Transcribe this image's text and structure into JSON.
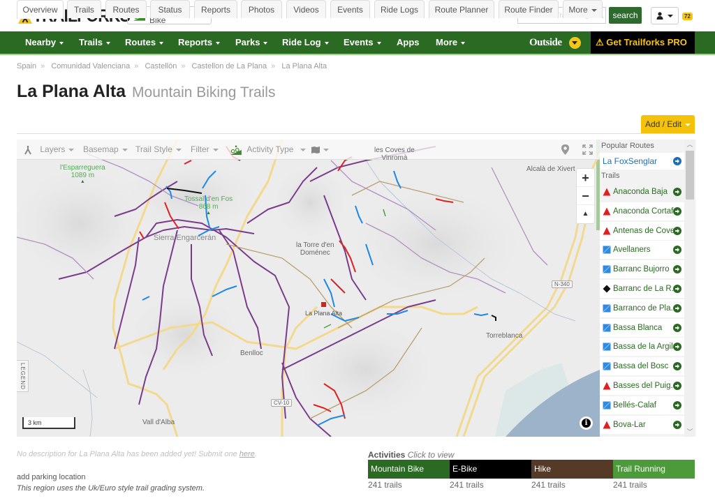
{
  "header": {
    "logo_text": "TRAILFORKS",
    "activity_select": "Mountain Bike",
    "search_placeholder": "Search for Trails, Regions, etc",
    "search_button": "search",
    "notification_count": "72"
  },
  "nav": {
    "items": [
      {
        "label": "Nearby",
        "dropdown": true
      },
      {
        "label": "Trails",
        "dropdown": true
      },
      {
        "label": "Routes",
        "dropdown": true
      },
      {
        "label": "Reports",
        "dropdown": true
      },
      {
        "label": "Parks",
        "dropdown": true
      },
      {
        "label": "Ride Log",
        "dropdown": true
      },
      {
        "label": "Events",
        "dropdown": true
      },
      {
        "label": "Apps",
        "dropdown": false
      },
      {
        "label": "More",
        "dropdown": true
      }
    ],
    "outside_label": "Outside",
    "pro_label": "Get Trailforks PRO"
  },
  "breadcrumb": [
    "Spain",
    "Comunidad Valenciana",
    "Castellón",
    "Castellon de La Plana",
    "La Plana Alta"
  ],
  "page": {
    "title": "La Plana Alta",
    "subtitle": "Mountain Biking Trails"
  },
  "tabs": [
    "Overview",
    "Trails",
    "Routes",
    "Status",
    "Reports",
    "Photos",
    "Videos",
    "Events",
    "Ride Logs",
    "Route Planner",
    "Route Finder",
    "More"
  ],
  "active_tab": "Overview",
  "add_edit_label": "Add / Edit",
  "map": {
    "toolbar": {
      "layers": "Layers",
      "basemap": "Basemap",
      "trail_style": "Trail Style",
      "filter": "Filter",
      "activity_type": "Activity Type"
    },
    "labels": {
      "esparreguera": "l'Esparreguera",
      "esparreguera_elev": "1089 m",
      "tossal": "Tossal d'en Fos",
      "tossal_elev": "868 m",
      "coves": "les Coves de",
      "coves2": "Vinromà",
      "alcala": "Alcalà de Xivert",
      "sierra": "Sierra Engarcerán",
      "torre": "la Torre d'en",
      "torre2": "Doménec",
      "plana": "La Plana Alta",
      "benlloc": "Benlloc",
      "torreblanca": "Torreblanca",
      "vall": "Vall d'Alba",
      "n340": "N-340",
      "cv10": "CV-10"
    },
    "legend_label": "LEGEND",
    "scale_label": "3 km",
    "zoom_in": "+",
    "zoom_out": "−"
  },
  "sidepanel": {
    "popular_routes_header": "Popular Routes",
    "popular_routes": [
      "La FoxSenglar"
    ],
    "trails_header": "Trails",
    "trails": [
      {
        "name": "Anaconda Baja",
        "difficulty": "red-triangle"
      },
      {
        "name": "Anaconda Cortaf...",
        "difficulty": "red-triangle"
      },
      {
        "name": "Antenas de Coves",
        "difficulty": "red-triangle"
      },
      {
        "name": "Avellaners",
        "difficulty": "blue-square"
      },
      {
        "name": "Barranc Bujorro",
        "difficulty": "blue-square"
      },
      {
        "name": "Barranc de La R...",
        "difficulty": "black-diamond"
      },
      {
        "name": "Barranco de Pla...",
        "difficulty": "blue-square"
      },
      {
        "name": "Bassa Blanca",
        "difficulty": "blue-square"
      },
      {
        "name": "Bassa de la Argila",
        "difficulty": "blue-square"
      },
      {
        "name": "Bassa del Bosc",
        "difficulty": "blue-square"
      },
      {
        "name": "Basses del Puig...",
        "difficulty": "red-triangle"
      },
      {
        "name": "Bellés-Calaf",
        "difficulty": "blue-square"
      },
      {
        "name": "Bova-Lar",
        "difficulty": "red-triangle"
      }
    ]
  },
  "description": {
    "text": "No description for La Plana Alta has been added yet! Submit one ",
    "link": "here",
    "end": ".",
    "parking": "add parking location",
    "grading": "This region uses the Uk/Euro style trail grading system."
  },
  "activities": {
    "title": "Activities",
    "hint": "Click to view",
    "items": [
      {
        "label": "Mountain Bike",
        "count": "241 trails",
        "color": "#2a6a22"
      },
      {
        "label": "E-Bike",
        "count": "241 trails",
        "color": "#000000"
      },
      {
        "label": "Hike",
        "count": "241 trails",
        "color": "#553a28"
      },
      {
        "label": "Trail Running",
        "count": "241 trails",
        "color": "#4d9a3a"
      }
    ]
  },
  "colors": {
    "brand_green": "#2a6a22",
    "accent_yellow": "#f5c20b",
    "pro_bg": "#000000",
    "trail_purple": "#7b3b8c",
    "trail_red": "#d42020",
    "trail_blue": "#1e88e5"
  }
}
